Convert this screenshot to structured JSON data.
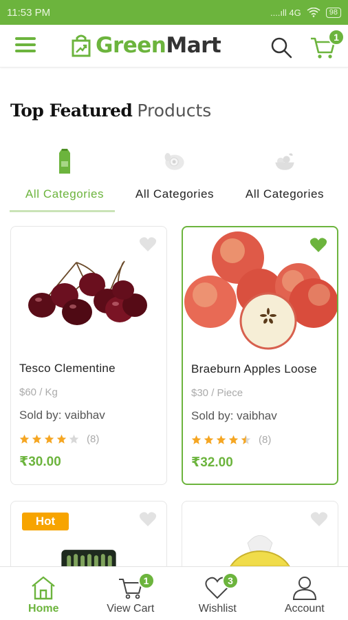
{
  "status_bar": {
    "time": "11:53 PM",
    "signal": "....ıll 4G",
    "battery": "98"
  },
  "app_bar": {
    "brand_green": "Green",
    "brand_dark": "Mart",
    "cart_count": "1"
  },
  "section": {
    "title_bold": "Top Featured",
    "title_light": "Products"
  },
  "category_tabs": [
    {
      "label": "All Categories",
      "icon": "milk-carton-icon",
      "active": true
    },
    {
      "label": "All Categories",
      "icon": "egg-icon",
      "active": false
    },
    {
      "label": "All Categories",
      "icon": "fruit-bowl-icon",
      "active": false
    }
  ],
  "products": [
    {
      "name": "Tesco Clementine",
      "unit": "$60 / Kg",
      "seller": "Sold by: vaibhav",
      "rating": 4,
      "rating_count": "(8)",
      "price": "₹30.00",
      "image": "cherries",
      "wishlisted": false
    },
    {
      "name": "Braeburn Apples Loose",
      "unit": "$30 / Piece",
      "seller": "Sold by: vaibhav",
      "rating": 4.5,
      "rating_count": "(8)",
      "price": "₹32.00",
      "image": "apples",
      "wishlisted": true
    },
    {
      "badge": "Hot",
      "image": "asparagus",
      "wishlisted": false
    },
    {
      "image": "bananas-pack",
      "wishlisted": false
    }
  ],
  "bottom_nav": [
    {
      "label": "Home",
      "icon": "home-icon",
      "active": true
    },
    {
      "label": "View Cart",
      "icon": "cart-icon",
      "badge": "1"
    },
    {
      "label": "Wishlist",
      "icon": "heart-icon",
      "badge": "3"
    },
    {
      "label": "Account",
      "icon": "user-icon"
    }
  ],
  "colors": {
    "primary_green": "#6cb43d",
    "hot_orange": "#f7a400",
    "star_gold": "#f5a623"
  }
}
